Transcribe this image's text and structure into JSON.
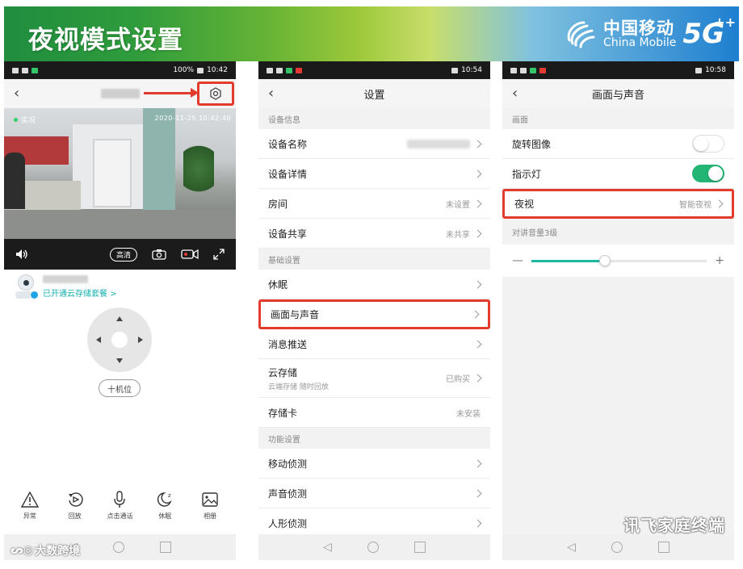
{
  "banner": {
    "title": "夜视模式设置",
    "brand_cn": "中国移动",
    "brand_en": "China Mobile",
    "brand_5g": "5G",
    "brand_plus": "++"
  },
  "phone1": {
    "status": {
      "battery": "100%",
      "time": "10:42"
    },
    "video": {
      "live_label": "实况",
      "timestamp": "2020-11-25  10:42:40"
    },
    "controls": {
      "quality": "高清"
    },
    "device": {
      "cloud_link": "已开通云存储套餐 >"
    },
    "preset_label": "十机位",
    "toolbar": [
      {
        "label": "异常",
        "icon": "warning-icon"
      },
      {
        "label": "回放",
        "icon": "playback-icon"
      },
      {
        "label": "点击通话",
        "icon": "microphone-icon"
      },
      {
        "label": "休眠",
        "icon": "sleep-icon"
      },
      {
        "label": "相册",
        "icon": "album-icon"
      }
    ],
    "watermark": "大数跨境"
  },
  "phone2": {
    "status": {
      "time": "10:54"
    },
    "title": "设置",
    "sections": [
      {
        "header": "设备信息",
        "rows": [
          {
            "label": "设备名称",
            "value": ""
          },
          {
            "label": "设备详情",
            "value": ""
          },
          {
            "label": "房间",
            "value": "未设置"
          },
          {
            "label": "设备共享",
            "value": "未共享"
          }
        ]
      },
      {
        "header": "基础设置",
        "rows": [
          {
            "label": "休眠",
            "value": ""
          },
          {
            "label": "画面与声音",
            "value": ""
          },
          {
            "label": "消息推送",
            "value": ""
          },
          {
            "label": "云存储",
            "sub": "云端存储 随时回放",
            "value": "已购买"
          },
          {
            "label": "存储卡",
            "value": "未安装"
          }
        ]
      },
      {
        "header": "功能设置",
        "rows": [
          {
            "label": "移动侦测",
            "value": ""
          },
          {
            "label": "声音侦测",
            "value": ""
          },
          {
            "label": "人形侦测",
            "value": ""
          }
        ]
      }
    ]
  },
  "phone3": {
    "status": {
      "time": "10:58"
    },
    "title": "画面与声音",
    "section_header": "画面",
    "rotate_label": "旋转图像",
    "rotate_on": false,
    "indicator_label": "指示灯",
    "indicator_on": true,
    "night_label": "夜视",
    "night_value": "智能夜视",
    "volume_header": "对讲音量3级",
    "volume_minus": "—",
    "volume_plus": "+",
    "volume_level": 0.42,
    "watermark": "讯飞家庭终端"
  },
  "colors": {
    "highlight": "#e23b2e",
    "toggle_on": "#22b573",
    "accent_teal": "#16b0b0"
  }
}
